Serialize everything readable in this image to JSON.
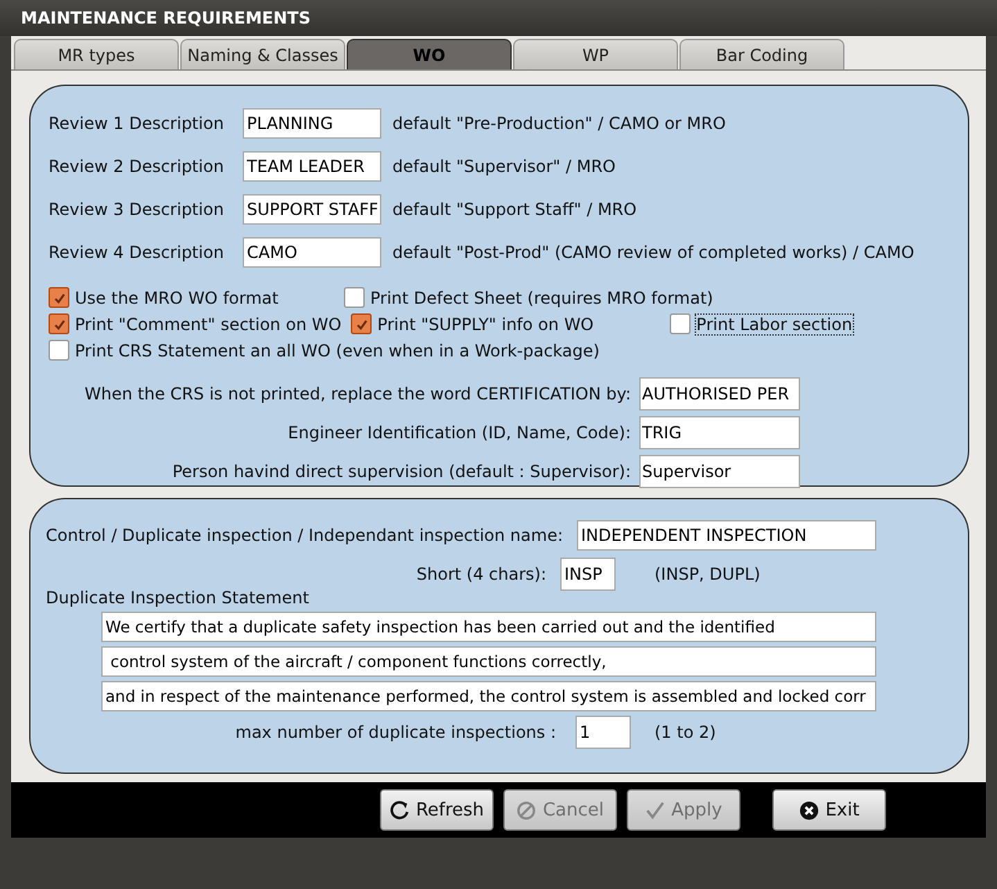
{
  "window": {
    "title": "MAINTENANCE REQUIREMENTS"
  },
  "tabs": [
    {
      "label": "MR types",
      "selected": false
    },
    {
      "label": "Naming & Classes",
      "selected": false
    },
    {
      "label": "WO",
      "selected": true
    },
    {
      "label": "WP",
      "selected": false
    },
    {
      "label": "Bar Coding",
      "selected": false
    }
  ],
  "reviews": [
    {
      "label": "Review 1 Description",
      "value": "PLANNING",
      "hint": "default \"Pre-Production\" / CAMO or MRO"
    },
    {
      "label": "Review 2 Description",
      "value": "TEAM LEADER",
      "hint": "default \"Supervisor\" / MRO"
    },
    {
      "label": "Review 3 Description",
      "value": "SUPPORT STAFF",
      "hint": "default \"Support Staff\" / MRO"
    },
    {
      "label": "Review 4 Description",
      "value": "CAMO",
      "hint": "default \"Post-Prod\" (CAMO review of completed works) / CAMO"
    }
  ],
  "options": [
    [
      {
        "label": "Use the MRO WO format",
        "checked": true,
        "focused": false
      },
      {
        "label": "Print Defect Sheet (requires MRO format)",
        "checked": false,
        "focused": false
      }
    ],
    [
      {
        "label": "Print \"Comment\" section on WO",
        "checked": true,
        "focused": false
      },
      {
        "label": "Print \"SUPPLY\" info on WO",
        "checked": true,
        "focused": false
      },
      {
        "label": "Print Labor section",
        "checked": false,
        "focused": true
      }
    ],
    [
      {
        "label": "Print CRS Statement an all WO (even when in a Work-package)",
        "checked": false,
        "focused": false
      }
    ]
  ],
  "crs_fields": [
    {
      "label": "When the CRS is not printed, replace the word CERTIFICATION by:",
      "value": "AUTHORISED PER"
    },
    {
      "label": "Engineer Identification (ID, Name, Code):",
      "value": "TRIG"
    },
    {
      "label": "Person havind direct supervision (default : Supervisor):",
      "value": "Supervisor"
    }
  ],
  "inspection": {
    "name_label": "Control / Duplicate inspection / Independant inspection name:",
    "name_value": "INDEPENDENT INSPECTION",
    "short_label": "Short (4 chars):",
    "short_value": "INSP",
    "short_hint": "(INSP, DUPL)",
    "statement_label": "Duplicate Inspection Statement",
    "statement_lines": [
      "We certify that a duplicate safety inspection has been carried out and the identified",
      " control system of the aircraft / component functions correctly,",
      "and in respect of the maintenance performed, the control system is assembled and locked corr"
    ],
    "max_label": "max number of duplicate inspections :",
    "max_value": "1",
    "max_hint": "(1 to 2)"
  },
  "buttons": [
    {
      "kind": "refresh",
      "label": "Refresh",
      "disabled": false
    },
    {
      "kind": "cancel",
      "label": "Cancel",
      "disabled": true
    },
    {
      "kind": "apply",
      "label": "Apply",
      "disabled": true
    },
    {
      "kind": "exit",
      "label": "Exit",
      "disabled": false
    }
  ]
}
